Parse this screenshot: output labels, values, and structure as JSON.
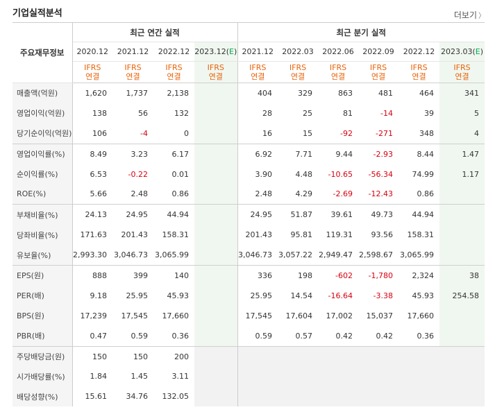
{
  "header": {
    "title": "기업실적분석",
    "more_label": "더보기",
    "more_arrow": "〉"
  },
  "table": {
    "label_header": "주요재무정보",
    "group_annual": "최근 연간 실적",
    "group_quarter": "최근 분기 실적",
    "periods": [
      "2020.12",
      "2021.12",
      "2022.12",
      "2023.12(E)",
      "2021.12",
      "2022.03",
      "2022.06",
      "2022.09",
      "2022.12",
      "2023.03(E)"
    ],
    "ifrs_top": "IFRS",
    "ifrs_bottom": "연결",
    "rows": [
      {
        "label": "매출액(억원)",
        "values": [
          "1,620",
          "1,737",
          "2,138",
          "",
          "404",
          "329",
          "863",
          "481",
          "464",
          "341"
        ]
      },
      {
        "label": "영업이익(억원)",
        "values": [
          "138",
          "56",
          "132",
          "",
          "28",
          "25",
          "81",
          "-14",
          "39",
          "5"
        ]
      },
      {
        "label": "당기순이익(억원)",
        "values": [
          "106",
          "-4",
          "0",
          "",
          "16",
          "15",
          "-92",
          "-271",
          "348",
          "4"
        ]
      },
      {
        "label": "영업이익률(%)",
        "values": [
          "8.49",
          "3.23",
          "6.17",
          "",
          "6.92",
          "7.71",
          "9.44",
          "-2.93",
          "8.44",
          "1.47"
        ]
      },
      {
        "label": "순이익률(%)",
        "values": [
          "6.53",
          "-0.22",
          "0.01",
          "",
          "3.90",
          "4.48",
          "-10.65",
          "-56.34",
          "74.99",
          "1.17"
        ]
      },
      {
        "label": "ROE(%)",
        "values": [
          "5.66",
          "2.48",
          "0.86",
          "",
          "2.48",
          "4.29",
          "-2.69",
          "-12.43",
          "0.86",
          ""
        ]
      },
      {
        "label": "부채비율(%)",
        "values": [
          "24.13",
          "24.95",
          "44.94",
          "",
          "24.95",
          "51.87",
          "39.61",
          "49.73",
          "44.94",
          ""
        ]
      },
      {
        "label": "당좌비율(%)",
        "values": [
          "171.63",
          "201.43",
          "158.31",
          "",
          "201.43",
          "95.81",
          "119.31",
          "93.56",
          "158.31",
          ""
        ]
      },
      {
        "label": "유보율(%)",
        "values": [
          "2,993.30",
          "3,046.73",
          "3,065.99",
          "",
          "3,046.73",
          "3,057.22",
          "2,949.47",
          "2,598.67",
          "3,065.99",
          ""
        ]
      },
      {
        "label": "EPS(원)",
        "values": [
          "888",
          "399",
          "140",
          "",
          "336",
          "198",
          "-602",
          "-1,780",
          "2,324",
          "38"
        ]
      },
      {
        "label": "PER(배)",
        "values": [
          "9.18",
          "25.95",
          "45.93",
          "",
          "25.95",
          "14.54",
          "-16.64",
          "-3.38",
          "45.93",
          "254.58"
        ]
      },
      {
        "label": "BPS(원)",
        "values": [
          "17,239",
          "17,545",
          "17,660",
          "",
          "17,545",
          "17,604",
          "17,002",
          "15,037",
          "17,660",
          ""
        ]
      },
      {
        "label": "PBR(배)",
        "values": [
          "0.47",
          "0.59",
          "0.36",
          "",
          "0.59",
          "0.57",
          "0.42",
          "0.42",
          "0.36",
          ""
        ]
      },
      {
        "label": "주당배당금(원)",
        "values": [
          "150",
          "150",
          "200",
          "",
          "",
          "",
          "",
          "",
          "",
          ""
        ]
      },
      {
        "label": "시가배당률(%)",
        "values": [
          "1.84",
          "1.45",
          "3.11",
          "",
          "",
          "",
          "",
          "",
          "",
          ""
        ]
      },
      {
        "label": "배당성향(%)",
        "values": [
          "15.61",
          "34.76",
          "132.05",
          "",
          "",
          "",
          "",
          "",
          "",
          ""
        ]
      }
    ]
  },
  "colors": {
    "negative": "#d6000f",
    "ifrs": "#e8630a",
    "estimate": "#00a650"
  }
}
